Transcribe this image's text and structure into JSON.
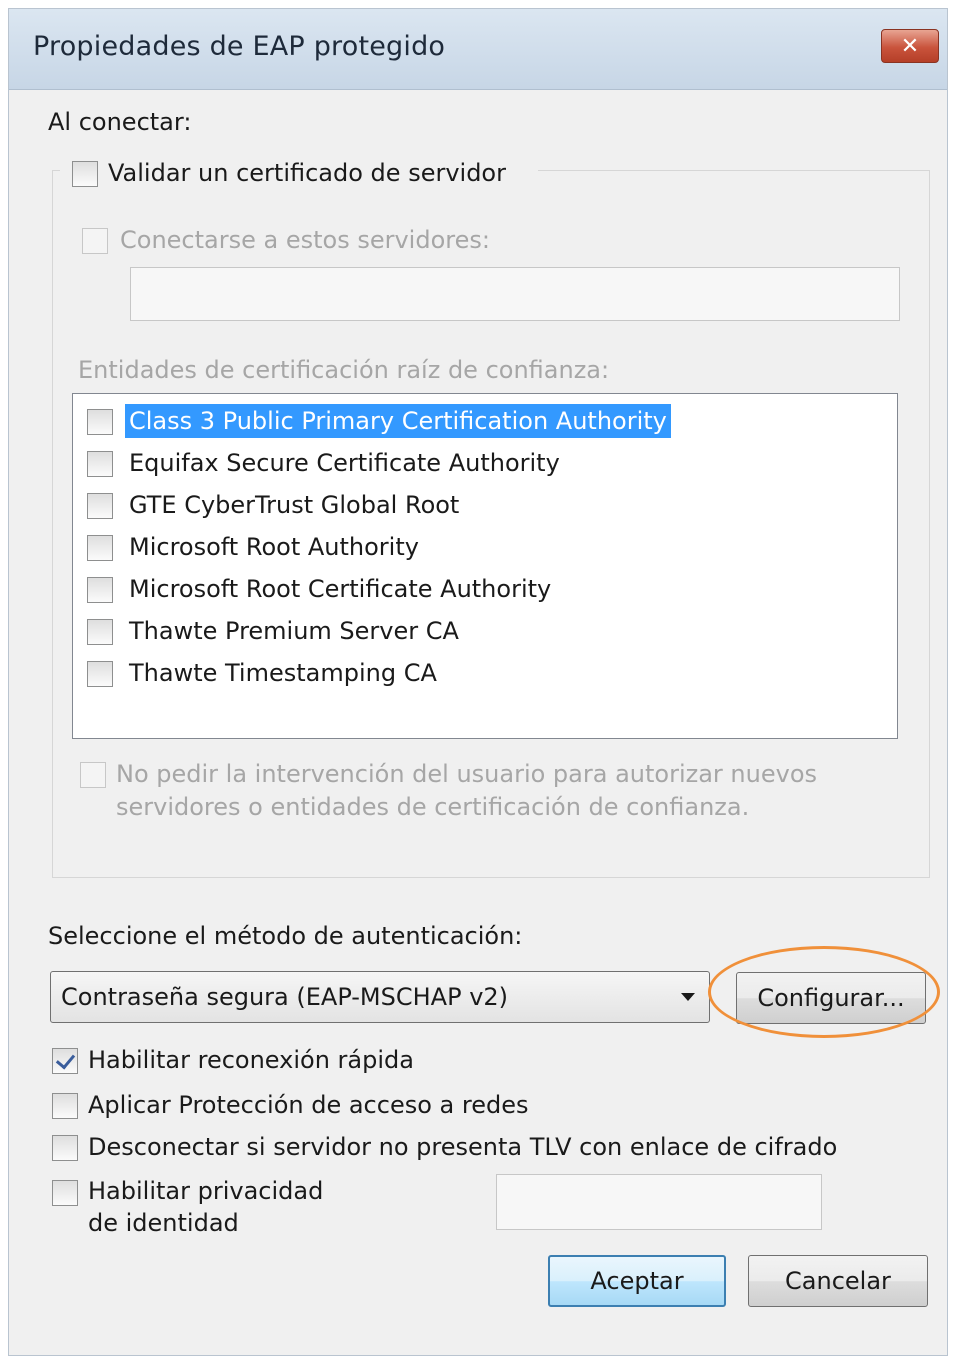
{
  "window": {
    "title": "Propiedades de EAP protegido",
    "close_symbol": "✕"
  },
  "connect": {
    "heading": "Al conectar:",
    "validate_cert": {
      "label": "Validar un certificado de servidor",
      "checked": false
    },
    "connect_servers": {
      "label": "Conectarse a estos servidores:",
      "checked": false,
      "value": ""
    },
    "trusted_roots": {
      "heading": "Entidades de certificación raíz de confianza:",
      "items": [
        {
          "label": "Class 3 Public Primary Certification Authority",
          "checked": false,
          "selected": true
        },
        {
          "label": "Equifax Secure Certificate Authority",
          "checked": false,
          "selected": false
        },
        {
          "label": "GTE CyberTrust Global Root",
          "checked": false,
          "selected": false
        },
        {
          "label": "Microsoft Root Authority",
          "checked": false,
          "selected": false
        },
        {
          "label": "Microsoft Root Certificate Authority",
          "checked": false,
          "selected": false
        },
        {
          "label": "Thawte Premium Server CA",
          "checked": false,
          "selected": false
        },
        {
          "label": "Thawte Timestamping CA",
          "checked": false,
          "selected": false
        }
      ]
    },
    "no_prompt": {
      "line1": "No pedir la intervención del usuario para autorizar nuevos",
      "line2": "servidores o entidades de certificación de confianza.",
      "checked": false
    }
  },
  "auth": {
    "heading": "Seleccione el método de autenticación:",
    "method": "Contraseña segura (EAP-MSCHAP v2)",
    "configure_label": "Configurar..."
  },
  "options": {
    "fast_reconnect": {
      "label": "Habilitar reconexión rápida",
      "checked": true
    },
    "nap": {
      "label": "Aplicar Protección de acceso a redes",
      "checked": false
    },
    "tlv": {
      "label": "Desconectar si servidor no presenta TLV con enlace de cifrado",
      "checked": false
    },
    "identity_privacy": {
      "line1": "Habilitar privacidad",
      "line2": "de identidad",
      "checked": false,
      "value": ""
    }
  },
  "buttons": {
    "ok": "Aceptar",
    "cancel": "Cancelar"
  },
  "colors": {
    "highlight_ring": "#f0903a",
    "selection": "#3399ff"
  }
}
